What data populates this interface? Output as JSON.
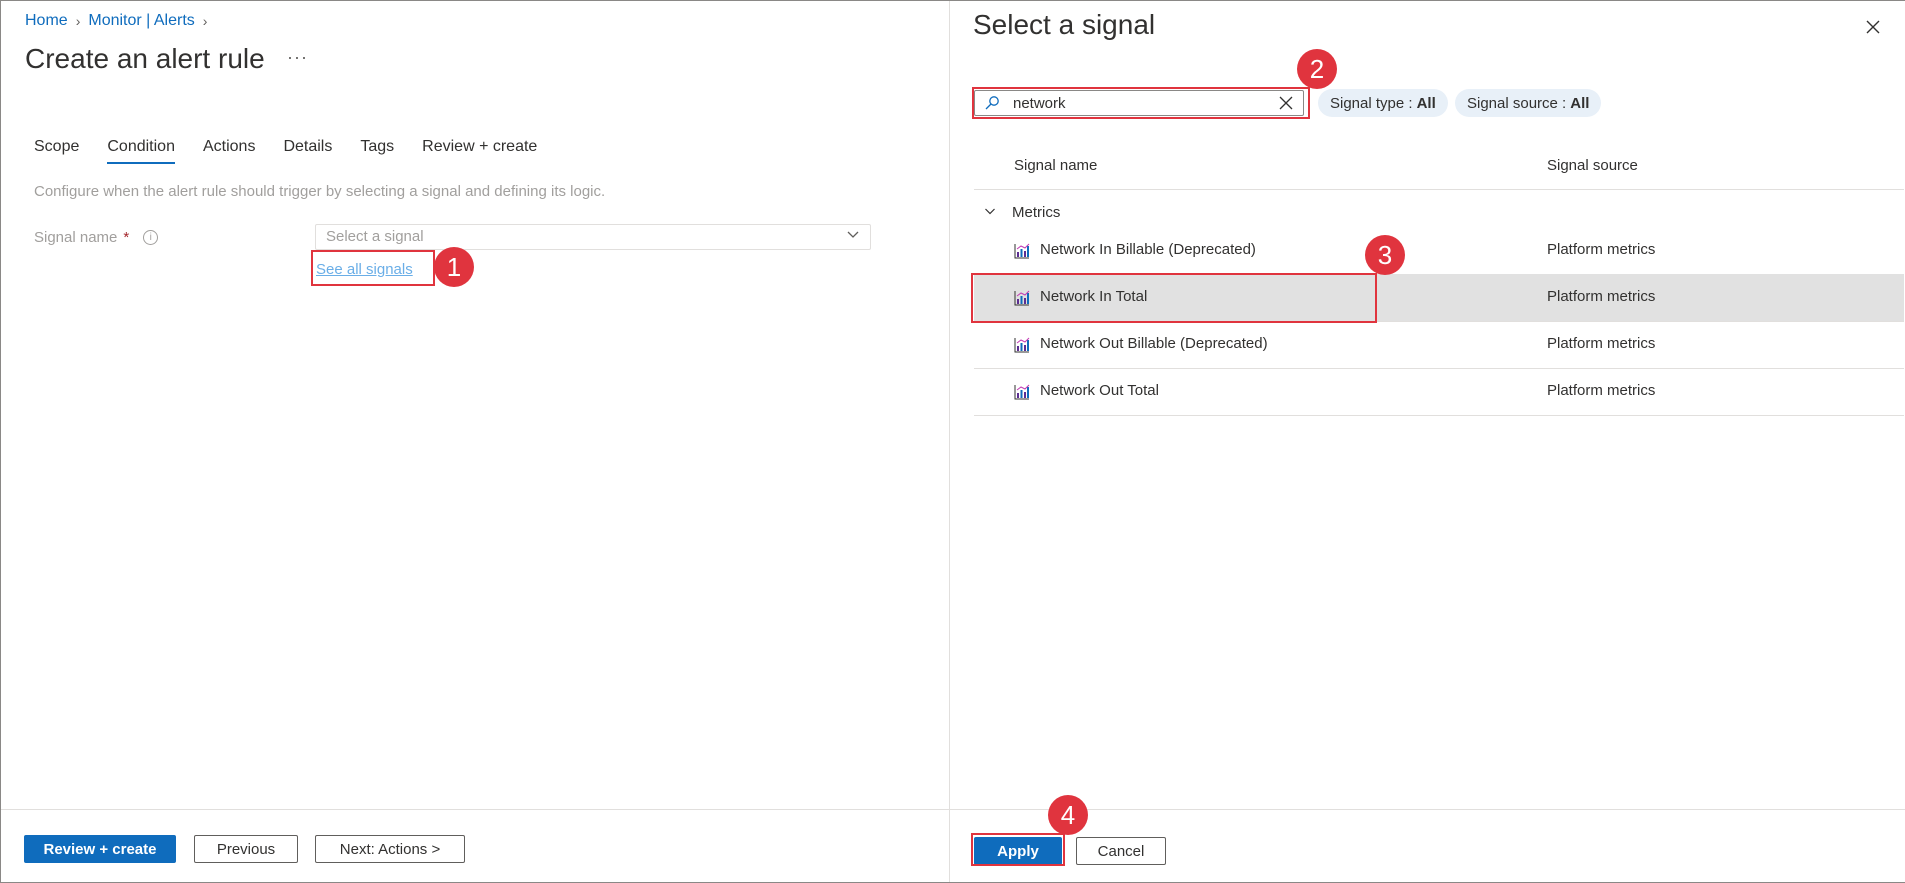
{
  "breadcrumb": {
    "items": [
      "Home",
      "Monitor | Alerts"
    ]
  },
  "page": {
    "title": "Create an alert rule",
    "more_label": "···"
  },
  "tabs": [
    {
      "label": "Scope",
      "active": false
    },
    {
      "label": "Condition",
      "active": true
    },
    {
      "label": "Actions",
      "active": false
    },
    {
      "label": "Details",
      "active": false
    },
    {
      "label": "Tags",
      "active": false
    },
    {
      "label": "Review + create",
      "active": false
    }
  ],
  "condition": {
    "description": "Configure when the alert rule should trigger by selecting a signal and defining its logic.",
    "signal_label": "Signal name",
    "required_mark": "*",
    "select_placeholder": "Select a signal",
    "see_all_link": "See all signals"
  },
  "left_footer": {
    "review_create": "Review + create",
    "previous": "Previous",
    "next": "Next: Actions >"
  },
  "panel": {
    "title": "Select a signal",
    "search_value": "network",
    "filters": [
      {
        "label": "Signal type :",
        "value": "All"
      },
      {
        "label": "Signal source :",
        "value": "All"
      }
    ],
    "columns": {
      "name": "Signal name",
      "source": "Signal source"
    },
    "group": "Metrics",
    "rows": [
      {
        "name": "Network In Billable (Deprecated)",
        "source": "Platform metrics",
        "selected": false
      },
      {
        "name": "Network In Total",
        "source": "Platform metrics",
        "selected": true
      },
      {
        "name": "Network Out Billable (Deprecated)",
        "source": "Platform metrics",
        "selected": false
      },
      {
        "name": "Network Out Total",
        "source": "Platform metrics",
        "selected": false
      }
    ],
    "apply": "Apply",
    "cancel": "Cancel"
  },
  "annotations": [
    "1",
    "2",
    "3",
    "4"
  ],
  "colors": {
    "accent": "#0f6cbd",
    "annotation": "#e0343e",
    "selected_row": "#e1e1e1",
    "pill_bg": "#e8f0f8"
  },
  "icons": {
    "metric": "metric-chart-icon",
    "search": "search-icon",
    "clear": "clear-icon",
    "close": "close-icon",
    "info": "info-icon",
    "group_toggle": "chevron-down-icon"
  }
}
